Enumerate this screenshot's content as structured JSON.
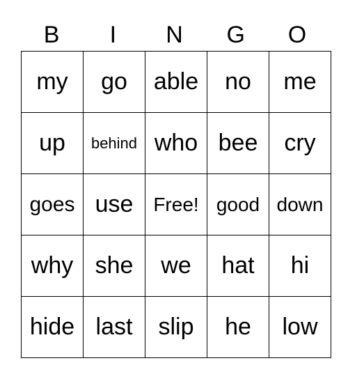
{
  "header": [
    "B",
    "I",
    "N",
    "G",
    "O"
  ],
  "rows": [
    [
      "my",
      "go",
      "able",
      "no",
      "me"
    ],
    [
      "up",
      "behind",
      "who",
      "bee",
      "cry"
    ],
    [
      "goes",
      "use",
      "Free!",
      "good",
      "down"
    ],
    [
      "why",
      "she",
      "we",
      "hat",
      "hi"
    ],
    [
      "hide",
      "last",
      "slip",
      "he",
      "low"
    ]
  ]
}
